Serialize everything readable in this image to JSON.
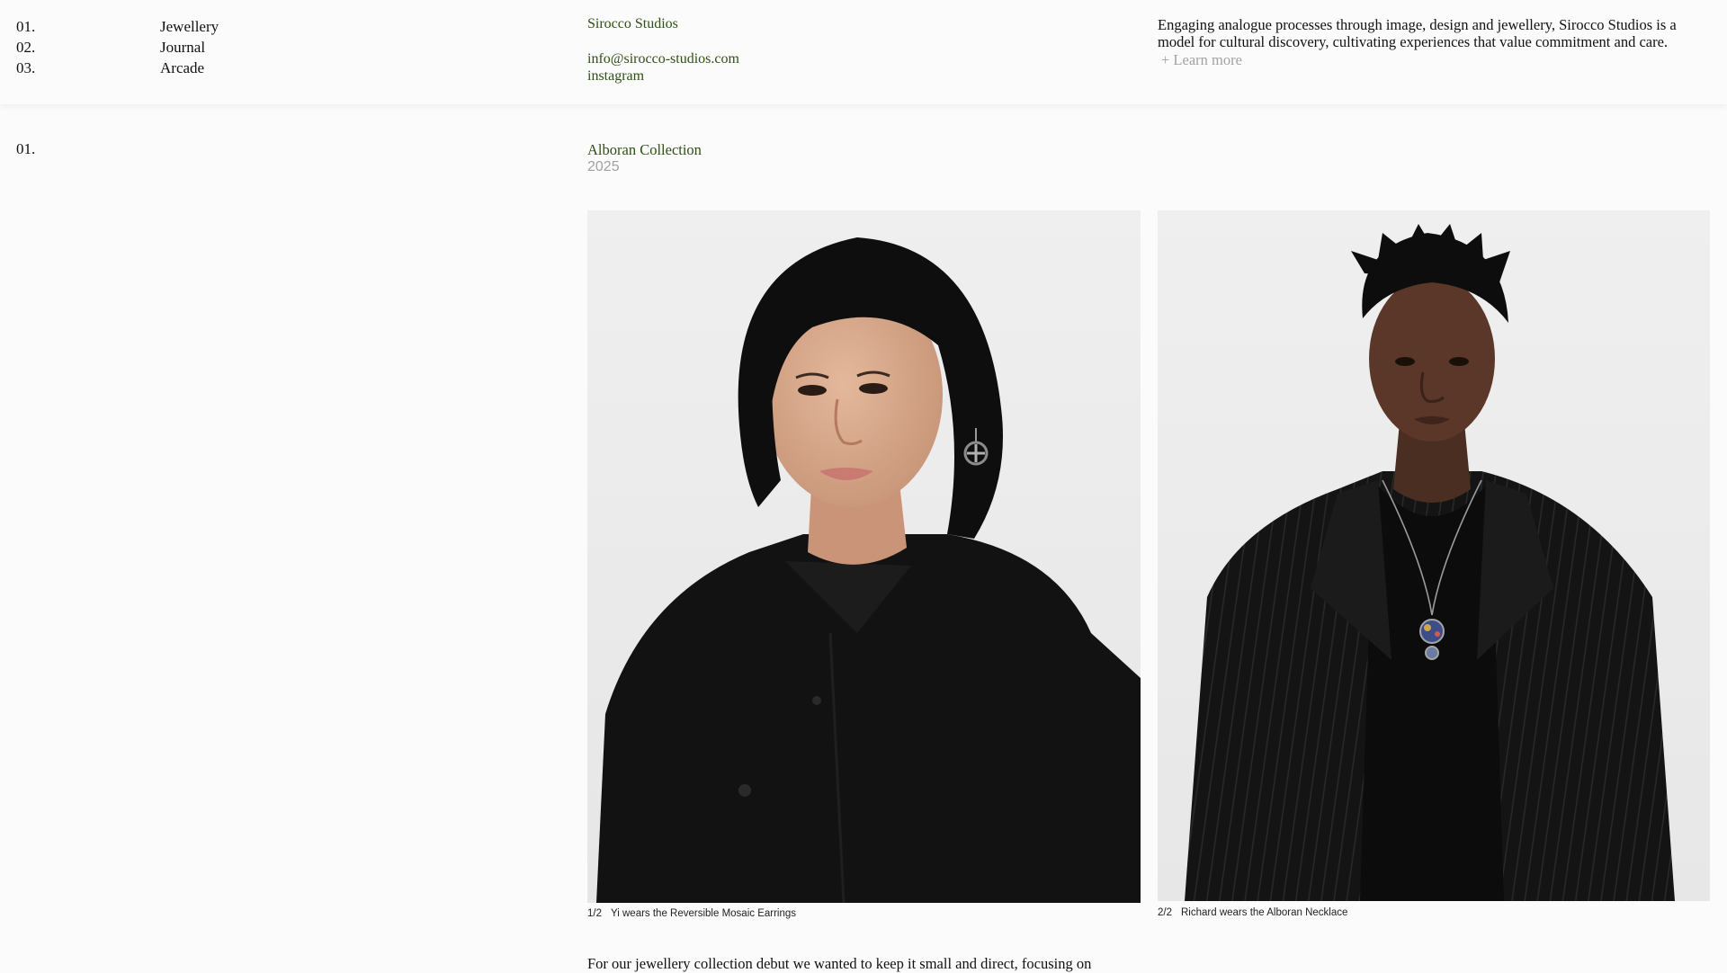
{
  "nav": {
    "items": [
      {
        "num": "01.",
        "label": "Jewellery"
      },
      {
        "num": "02.",
        "label": "Journal"
      },
      {
        "num": "03.",
        "label": "Arcade"
      }
    ]
  },
  "brand": {
    "name": "Sirocco Studios",
    "email": "info@sirocco-studios.com",
    "instagram": "instagram"
  },
  "about": {
    "text": "Engaging analogue processes through image, design and jewellery, Sirocco Studios is a model for cultural discovery, cultivating experiences that value commitment and care.",
    "learn_more": "+ Learn more"
  },
  "section": {
    "num": "01.",
    "title": "Alboran Collection",
    "year": "2025"
  },
  "photos": [
    {
      "index": "1/2",
      "caption": "Yi wears the Reversible Mosaic Earrings"
    },
    {
      "index": "2/2",
      "caption": "Richard wears the Alboran Necklace"
    }
  ],
  "body": {
    "intro": "For our jewellery collection debut we wanted to keep it small and direct, focusing on"
  },
  "colors": {
    "accent_green": "#2f4f14",
    "muted_gray": "#a2a2a2",
    "background": "#fbfbfb"
  }
}
